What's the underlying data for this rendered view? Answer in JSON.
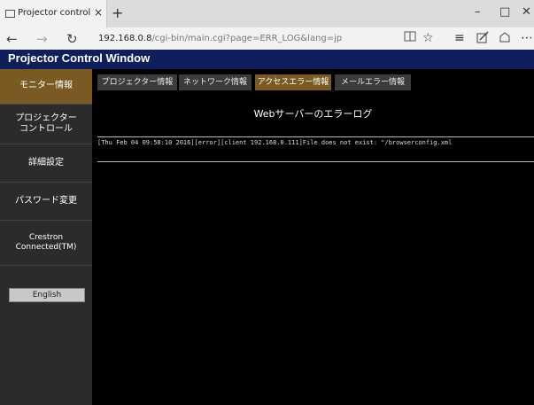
{
  "browser": {
    "tab_title": "Projector control windo",
    "tab_close": "×",
    "new_tab": "+",
    "window_buttons": {
      "minimize": "–",
      "maximize": "□",
      "close": "✕"
    },
    "back": "←",
    "forward": "→",
    "refresh": "↻",
    "url_host": "192.168.0.8",
    "url_path": "/cgi-bin/main.cgi?page=ERR_LOG&lang=jp",
    "toolbar_icons": [
      "reading-view-icon",
      "favorite-star-icon",
      "hub-icon",
      "web-note-icon",
      "share-icon",
      "more-icon"
    ]
  },
  "header": {
    "title": "Projector Control Window"
  },
  "sidebar": {
    "items": [
      {
        "label": "モニター情報",
        "active": true
      },
      {
        "label": "プロジェクター\nコントロール",
        "active": false
      },
      {
        "label": "詳細設定",
        "active": false
      },
      {
        "label": "パスワード変更",
        "active": false
      },
      {
        "label": "Crestron\nConnected(TM)",
        "active": false
      }
    ],
    "english_button": "English"
  },
  "subtabs": [
    {
      "label": "プロジェクター情報",
      "active": false
    },
    {
      "label": "ネットワーク情報",
      "active": false
    },
    {
      "label": "アクセスエラー情報",
      "active": true
    },
    {
      "label": "メールエラー情報",
      "active": false
    }
  ],
  "log": {
    "title": "Webサーバーのエラーログ",
    "lines": [
      "[Thu Feb 04 09:58:10 2016][error][client 192.168.0.111]File does not exist: \"/browserconfig.xml"
    ]
  },
  "colors": {
    "header_bg": "#0f1f5c",
    "active_bg": "#7a5a22",
    "sidebar_bg": "#2b2b2b",
    "content_bg": "#000000"
  }
}
